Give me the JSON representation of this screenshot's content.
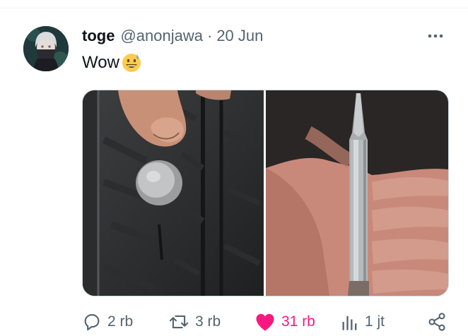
{
  "tweet": {
    "display_name": "toge",
    "handle": "@anonjawa",
    "separator": "·",
    "date": "20 Jun",
    "text": "Wow",
    "emoji": "grinning-face-with-sweat"
  },
  "media": {
    "photos": [
      {
        "subject": "tire-with-embedded-object-photo"
      },
      {
        "subject": "hand-holding-bullet-photo"
      }
    ]
  },
  "actions": {
    "reply_count": "2 rb",
    "retweet_count": "3 rb",
    "like_count": "31 rb",
    "views_count": "1 jt"
  },
  "colors": {
    "like": "#f91880",
    "muted": "#536471",
    "text": "#0f1419"
  }
}
